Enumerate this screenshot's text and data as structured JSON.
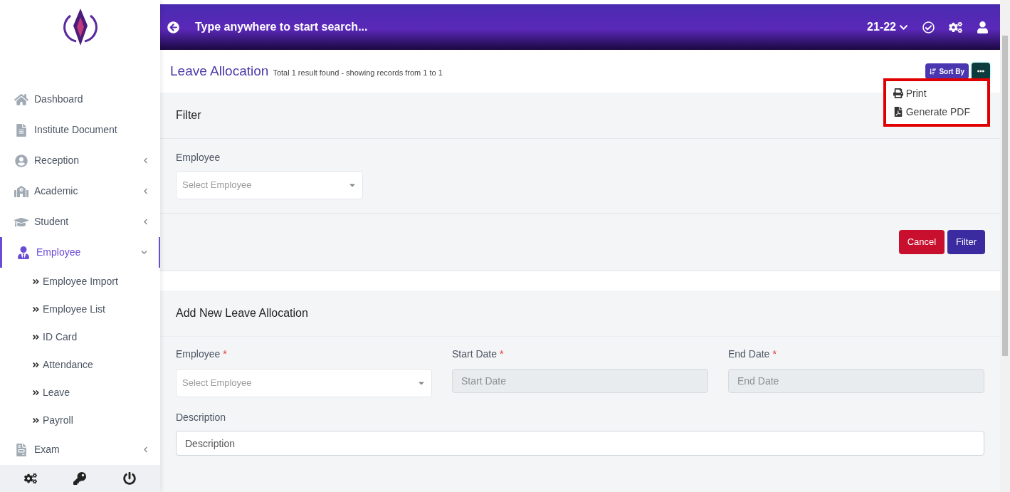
{
  "header": {
    "search_placeholder": "Type anywhere to start search...",
    "session": "21-22"
  },
  "sidebar": {
    "items": [
      {
        "label": "Dashboard",
        "selected": false
      },
      {
        "label": "Institute Document",
        "selected": false
      },
      {
        "label": "Reception",
        "selected": false,
        "expanded": false
      },
      {
        "label": "Academic",
        "selected": false,
        "expanded": false
      },
      {
        "label": "Student",
        "selected": false,
        "expanded": false
      },
      {
        "label": "Employee",
        "selected": true,
        "expanded": true,
        "children": [
          {
            "label": "Employee Import"
          },
          {
            "label": "Employee List"
          },
          {
            "label": "ID Card"
          },
          {
            "label": "Attendance"
          },
          {
            "label": "Leave"
          },
          {
            "label": "Payroll"
          }
        ]
      },
      {
        "label": "Exam",
        "selected": false,
        "expanded": false
      }
    ]
  },
  "page": {
    "title": "Leave Allocation",
    "summary": "Total 1 result found - showing records from 1 to 1",
    "sort_button": "Sort By",
    "menu": {
      "highlighted": true,
      "items": [
        "Print",
        "Generate PDF"
      ]
    }
  },
  "filter": {
    "title": "Filter",
    "field": {
      "label": "Employee",
      "placeholder": "Select Employee"
    },
    "buttons": [
      "Cancel",
      "Filter"
    ]
  },
  "form": {
    "title": "Add New Leave Allocation",
    "fields": [
      {
        "kind": "select",
        "label": "Employee",
        "required_mark": "*",
        "placeholder": "Select Employee"
      },
      {
        "kind": "input",
        "label": "Start Date",
        "required_mark": "*",
        "placeholder": "Start Date",
        "disabled": true
      },
      {
        "kind": "input",
        "label": "End Date",
        "required_mark": "*",
        "placeholder": "End Date",
        "disabled": true
      }
    ],
    "description": {
      "label": "Description",
      "placeholder": "Description"
    }
  }
}
